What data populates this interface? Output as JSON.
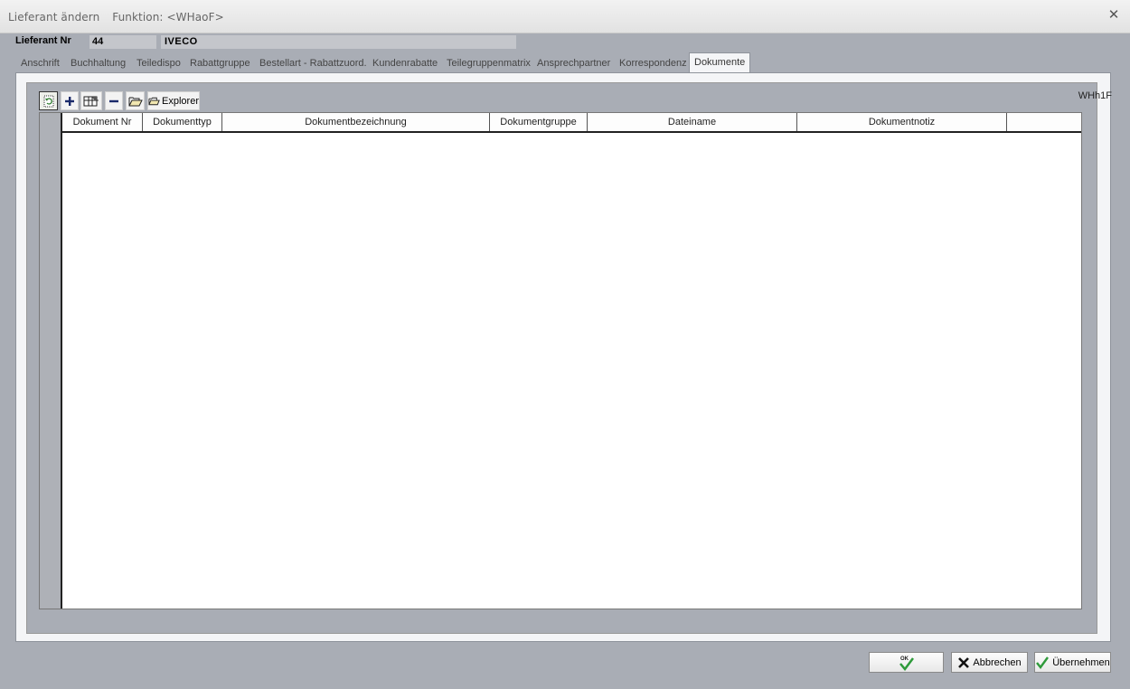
{
  "window": {
    "title": "Lieferant ändern",
    "function_label": "Funktion: <WHaoF>"
  },
  "header": {
    "lieferant_label": "Lieferant Nr",
    "lieferant_nr": "44",
    "lieferant_name": "IVECO"
  },
  "tabs": [
    {
      "label": "Anschrift"
    },
    {
      "label": "Buchhaltung"
    },
    {
      "label": "Teiledispo"
    },
    {
      "label": "Rabattgruppe"
    },
    {
      "label": "Bestellart - Rabattzuord."
    },
    {
      "label": "Kundenrabatte"
    },
    {
      "label": "Teilegruppenmatrix"
    },
    {
      "label": "Ansprechpartner"
    },
    {
      "label": "Korrespondenz"
    },
    {
      "label": "Dokumente"
    }
  ],
  "active_tab": "Dokumente",
  "panel": {
    "code": "WHh1F",
    "toolbar": {
      "explorer_label": "Explorer"
    },
    "grid": {
      "columns": [
        {
          "label": "Dokument Nr"
        },
        {
          "label": "Dokumenttyp"
        },
        {
          "label": "Dokumentbezeichnung"
        },
        {
          "label": "Dokumentgruppe"
        },
        {
          "label": "Dateiname"
        },
        {
          "label": "Dokumentnotiz"
        },
        {
          "label": ""
        }
      ],
      "rows": []
    }
  },
  "footer": {
    "ok_icon_text": "OK",
    "cancel_label": "Abbrechen",
    "apply_label": "Übernehmen"
  },
  "colors": {
    "background": "#a9adb5",
    "panel": "#f4f5f7",
    "grid_background": "#ffffff",
    "check_green": "#2e9a3a"
  }
}
